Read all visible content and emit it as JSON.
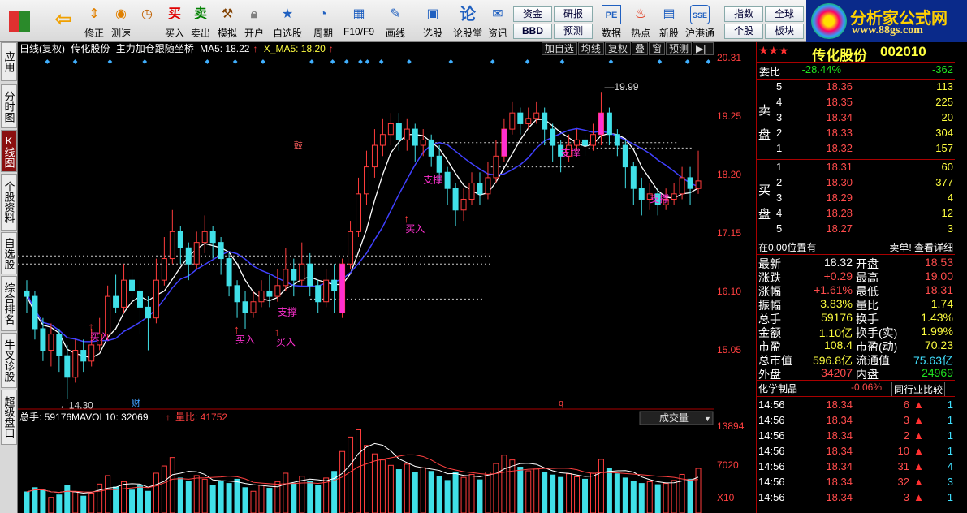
{
  "toolbar": {
    "items": [
      {
        "label": "",
        "icon": "windows-grid-icon"
      },
      {
        "label": "",
        "icon": "back-arrow-icon"
      },
      {
        "label": "修正",
        "icon": "fix-icon"
      },
      {
        "label": "测速",
        "icon": "speed-clock-icon"
      },
      {
        "label": "买入",
        "icon": "buy-icon"
      },
      {
        "label": "卖出",
        "icon": "sell-icon"
      },
      {
        "label": "模拟",
        "icon": "simulate-hammer-icon"
      },
      {
        "label": "开户",
        "icon": "lock-icon"
      },
      {
        "label": "自选股",
        "icon": "star-icon"
      },
      {
        "label": "周期",
        "icon": "clock-icon"
      },
      {
        "label": "F10/F9",
        "icon": "info-table-icon"
      },
      {
        "label": "画线",
        "icon": "pen-icon"
      },
      {
        "label": "选股",
        "icon": "select-stock-icon"
      },
      {
        "label": "论股堂",
        "icon": "forum-icon"
      },
      {
        "label": "资讯",
        "icon": "news-icon"
      },
      {
        "label": "数据",
        "icon": "pe-data-icon"
      },
      {
        "label": "热点",
        "icon": "hot-icon"
      },
      {
        "label": "新股",
        "icon": "new-stock-icon"
      },
      {
        "label": "沪港通",
        "icon": "sse-hke-icon"
      }
    ],
    "buy_glyph": "买",
    "sell_glyph": "卖",
    "forum_glyph": "论",
    "small_buttons": [
      "资金",
      "BBD",
      "研报",
      "预测",
      "指数",
      "个股",
      "全球",
      "板块"
    ],
    "logo_title": "分析家公式网",
    "logo_url": "www.88gs.com"
  },
  "left_tabs": [
    "应用",
    "分时图",
    "K线图",
    "个股资料",
    "自选股",
    "综合排名",
    "牛叉诊股",
    "超级盘口"
  ],
  "chart": {
    "header": [
      "日线(复权)",
      "传化股份",
      "主力加仓跟随坐桥",
      "MA5: 18.22",
      "X_MA5: 18.20"
    ],
    "buttons": [
      "加自选",
      "均线",
      "复权",
      "叠",
      "窗",
      "预测"
    ],
    "y_labels": [
      "20.31",
      "19.25",
      "18.20",
      "17.15",
      "16.10",
      "15.05"
    ],
    "vol_labels": [
      "13894",
      "7020",
      "X10"
    ],
    "high_label": "19.99",
    "low_label": "14.30",
    "annotations": [
      "买入",
      "买入",
      "买入",
      "买入",
      "支撑",
      "支撑",
      "支撑",
      "支撑",
      "财",
      "q",
      "鼓"
    ],
    "vol_header": {
      "total": "总手: 59176",
      "mavol": "MAVOL10: 32069",
      "ratio": "量比: 41752",
      "dropdown": "成交量"
    }
  },
  "chart_data": {
    "type": "candlestick",
    "ylim": [
      14.2,
      20.4
    ],
    "candles": [
      [
        16.3,
        16.2,
        16.5,
        15.9
      ],
      [
        16.2,
        15.6,
        16.3,
        15.4
      ],
      [
        15.6,
        15.2,
        15.8,
        15.0
      ],
      [
        15.2,
        15.5,
        15.7,
        14.9
      ],
      [
        15.5,
        15.1,
        15.6,
        14.8
      ],
      [
        15.1,
        14.7,
        15.3,
        14.3
      ],
      [
        14.7,
        15.2,
        15.4,
        14.6
      ],
      [
        15.2,
        15.0,
        15.4,
        14.8
      ],
      [
        15.0,
        15.3,
        15.6,
        14.9
      ],
      [
        15.3,
        15.5,
        15.8,
        15.2
      ],
      [
        15.5,
        16.2,
        16.4,
        15.4
      ],
      [
        16.2,
        16.0,
        16.6,
        15.9
      ],
      [
        16.0,
        16.5,
        16.8,
        15.9
      ],
      [
        16.5,
        16.3,
        16.7,
        16.0
      ],
      [
        16.3,
        16.0,
        16.5,
        15.5
      ],
      [
        16.0,
        15.8,
        16.2,
        15.2
      ],
      [
        15.8,
        16.5,
        16.9,
        15.7
      ],
      [
        16.5,
        16.9,
        17.3,
        16.4
      ],
      [
        16.9,
        17.4,
        17.8,
        16.8
      ],
      [
        17.4,
        17.1,
        17.5,
        16.8
      ],
      [
        17.1,
        16.8,
        17.2,
        16.5
      ],
      [
        16.8,
        17.2,
        17.4,
        16.7
      ],
      [
        17.2,
        17.4,
        17.7,
        17.0
      ],
      [
        17.4,
        17.2,
        17.5,
        16.9
      ],
      [
        17.2,
        16.9,
        17.3,
        16.6
      ],
      [
        16.9,
        16.4,
        17.0,
        16.2
      ],
      [
        16.4,
        16.1,
        16.5,
        15.8
      ],
      [
        16.1,
        15.9,
        16.3,
        15.6
      ],
      [
        15.9,
        16.1,
        16.3,
        15.8
      ],
      [
        16.1,
        16.3,
        16.5,
        16.0
      ],
      [
        16.3,
        16.2,
        16.6,
        16.0
      ],
      [
        16.2,
        16.4,
        16.7,
        16.1
      ],
      [
        16.4,
        16.7,
        17.1,
        16.3
      ],
      [
        16.7,
        16.5,
        16.9,
        16.2
      ],
      [
        16.5,
        16.8,
        17.2,
        16.4
      ],
      [
        16.8,
        16.4,
        17.0,
        16.2
      ],
      [
        16.4,
        16.1,
        16.5,
        15.9
      ],
      [
        16.1,
        16.5,
        16.7,
        16.0
      ],
      [
        16.5,
        16.3,
        16.8,
        15.9
      ],
      [
        15.9,
        16.8,
        16.9,
        15.8
      ],
      [
        16.8,
        17.4,
        17.6,
        16.7
      ],
      [
        17.4,
        18.1,
        18.4,
        17.3
      ],
      [
        18.1,
        18.6,
        18.9,
        17.9
      ],
      [
        18.6,
        19.0,
        19.3,
        18.4
      ],
      [
        19.0,
        19.2,
        19.5,
        18.8
      ],
      [
        19.2,
        19.4,
        19.6,
        19.0
      ],
      [
        19.4,
        19.1,
        19.6,
        18.9
      ],
      [
        19.1,
        19.3,
        19.5,
        18.9
      ],
      [
        19.3,
        19.0,
        19.4,
        18.7
      ],
      [
        19.0,
        19.1,
        19.3,
        18.8
      ],
      [
        19.1,
        18.8,
        19.2,
        18.6
      ],
      [
        18.8,
        18.5,
        19.0,
        18.3
      ],
      [
        18.5,
        18.2,
        18.6,
        17.9
      ],
      [
        18.2,
        17.8,
        18.3,
        17.5
      ],
      [
        17.8,
        18.0,
        18.2,
        17.6
      ],
      [
        18.0,
        18.3,
        18.5,
        17.9
      ],
      [
        18.3,
        18.1,
        18.5,
        17.9
      ],
      [
        18.1,
        18.4,
        18.7,
        18.0
      ],
      [
        18.4,
        18.8,
        19.1,
        18.3
      ],
      [
        18.8,
        19.3,
        19.5,
        18.7
      ],
      [
        19.3,
        19.6,
        19.8,
        19.2
      ],
      [
        19.6,
        19.4,
        19.7,
        19.2
      ],
      [
        19.4,
        19.5,
        19.7,
        19.3
      ],
      [
        19.5,
        19.6,
        19.8,
        19.4
      ],
      [
        19.6,
        19.3,
        19.7,
        19.0
      ],
      [
        19.3,
        19.0,
        19.4,
        18.7
      ],
      [
        19.0,
        18.8,
        19.1,
        18.5
      ],
      [
        18.8,
        19.0,
        19.2,
        18.7
      ],
      [
        19.0,
        19.1,
        19.3,
        18.9
      ],
      [
        19.1,
        19.0,
        19.2,
        18.8
      ],
      [
        19.0,
        19.2,
        19.4,
        18.9
      ],
      [
        19.2,
        19.6,
        19.99,
        19.0
      ],
      [
        19.6,
        19.2,
        19.7,
        19.0
      ],
      [
        19.2,
        19.0,
        19.3,
        18.8
      ],
      [
        19.0,
        18.6,
        19.1,
        18.2
      ],
      [
        18.6,
        18.2,
        18.7,
        17.9
      ],
      [
        18.2,
        18.0,
        18.4,
        17.7
      ],
      [
        18.0,
        18.1,
        18.3,
        17.8
      ],
      [
        18.1,
        17.9,
        18.2,
        17.7
      ],
      [
        17.9,
        18.0,
        18.2,
        17.8
      ],
      [
        18.0,
        18.1,
        18.3,
        17.9
      ],
      [
        18.1,
        18.4,
        18.6,
        18.0
      ],
      [
        18.4,
        18.2,
        18.6,
        17.9
      ],
      [
        18.2,
        18.34,
        18.9,
        18.1
      ]
    ],
    "volumes": [
      3500,
      4200,
      3800,
      2600,
      3000,
      4600,
      3500,
      2800,
      3300,
      4800,
      6200,
      4300,
      5200,
      3800,
      4500,
      3600,
      6600,
      7800,
      9200,
      5800,
      5200,
      6200,
      5600,
      4600,
      5200,
      4900,
      5600,
      4200,
      3600,
      4600,
      4100,
      5200,
      6600,
      4900,
      6100,
      5300,
      4600,
      5800,
      6900,
      10200,
      12600,
      13800,
      11200,
      9800,
      8800,
      7900,
      7200,
      8100,
      6700,
      7500,
      6900,
      6100,
      5400,
      6800,
      5900,
      6400,
      5500,
      6800,
      8200,
      9600,
      8800,
      7600,
      7000,
      7300,
      6800,
      6300,
      5900,
      6500,
      6000,
      5600,
      6600,
      8900,
      7400,
      6500,
      5800,
      5300,
      4900,
      5200,
      4700,
      4900,
      5400,
      6400,
      5600,
      7400
    ]
  },
  "quote": {
    "stars": "★★★",
    "name": "传化股份",
    "code": "002010",
    "weibi_label": "委比",
    "weibi": "-28.44%",
    "weicha": "-362",
    "sell_label_1": "卖",
    "sell_label_2": "盘",
    "buy_label_1": "买",
    "buy_label_2": "盘",
    "sells": [
      [
        "5",
        "18.36",
        "113"
      ],
      [
        "4",
        "18.35",
        "225"
      ],
      [
        "3",
        "18.34",
        "20"
      ],
      [
        "2",
        "18.33",
        "304"
      ],
      [
        "1",
        "18.32",
        "157"
      ]
    ],
    "buys": [
      [
        "1",
        "18.31",
        "60"
      ],
      [
        "2",
        "18.30",
        "377"
      ],
      [
        "3",
        "18.29",
        "4"
      ],
      [
        "4",
        "18.28",
        "12"
      ],
      [
        "5",
        "18.27",
        "3"
      ]
    ],
    "notice_left": "在0.00位置有",
    "notice_right": "卖单! 查看详细",
    "stats": [
      [
        "最新",
        "18.32",
        "开盘",
        "18.53"
      ],
      [
        "涨跌",
        "+0.29",
        "最高",
        "19.00"
      ],
      [
        "涨幅",
        "+1.61%",
        "最低",
        "18.31"
      ],
      [
        "振幅",
        "3.83%",
        "量比",
        "1.74"
      ],
      [
        "总手",
        "59176",
        "换手",
        "1.43%"
      ],
      [
        "金额",
        "1.10亿",
        "换手(实)",
        "1.99%"
      ],
      [
        "市盈",
        "108.4",
        "市盈(动)",
        "70.23"
      ],
      [
        "总市值",
        "596.8亿",
        "流通值",
        "75.63亿"
      ],
      [
        "外盘",
        "34207",
        "内盘",
        "24969"
      ]
    ],
    "industry": "化学制品",
    "industry_chg": "-0.06%",
    "industry_cmp": "同行业比较",
    "ticks": [
      [
        "14:56",
        "18.34",
        "6",
        "1"
      ],
      [
        "14:56",
        "18.34",
        "3",
        "1"
      ],
      [
        "14:56",
        "18.34",
        "2",
        "1"
      ],
      [
        "14:56",
        "18.34",
        "10",
        "1"
      ],
      [
        "14:56",
        "18.34",
        "31",
        "4"
      ],
      [
        "14:56",
        "18.34",
        "32",
        "3"
      ],
      [
        "14:56",
        "18.34",
        "3",
        "1"
      ]
    ]
  },
  "colors": {
    "up": "#ff3c3c",
    "down": "#40e0e8",
    "ma": "#ffffff",
    "accent": "#ff2fd0"
  }
}
